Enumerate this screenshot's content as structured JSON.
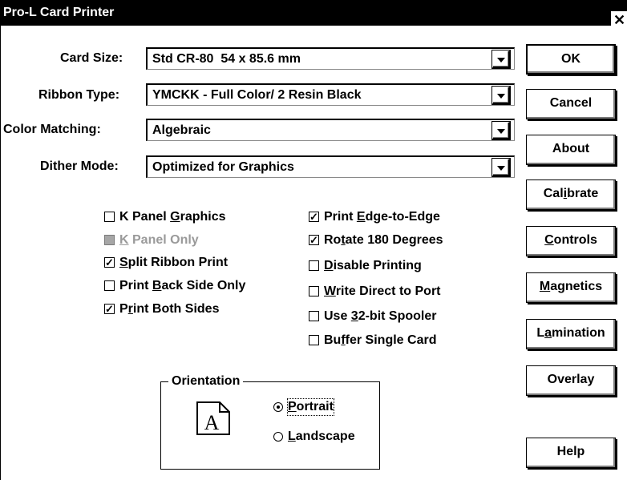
{
  "window": {
    "title": "Pro-L Card Printer",
    "close_glyph": "✕"
  },
  "fields": [
    {
      "label": "Card Size:",
      "value": "Std CR-80  54 x 85.6 mm"
    },
    {
      "label": "Ribbon Type:",
      "value": "YMCKK - Full Color/ 2 Resin Black"
    },
    {
      "label": "Color Matching:",
      "value": "Algebraic"
    },
    {
      "label": "Dither Mode:",
      "value": "Optimized for Graphics"
    }
  ],
  "buttons": {
    "ok": "OK",
    "cancel": "Cancel",
    "about": "About",
    "calibrate": {
      "pre": "Cal",
      "acc": "i",
      "post": "brate"
    },
    "controls": {
      "pre": "",
      "acc": "C",
      "post": "ontrols"
    },
    "magnetics": {
      "pre": "",
      "acc": "M",
      "post": "agnetics"
    },
    "lamination": {
      "pre": "L",
      "acc": "a",
      "post": "mination"
    },
    "overlay": "Overlay",
    "help": "Help"
  },
  "options_left": [
    {
      "pre": "K Panel ",
      "acc": "G",
      "post": "raphics",
      "checked": false,
      "enabled": true
    },
    {
      "pre": "",
      "acc": "K",
      "post": " Panel Only",
      "checked": false,
      "enabled": false
    },
    {
      "pre": "",
      "acc": "S",
      "post": "plit Ribbon Print",
      "checked": true,
      "enabled": true
    },
    {
      "pre": "Print ",
      "acc": "B",
      "post": "ack Side Only",
      "checked": false,
      "enabled": true
    },
    {
      "pre": "P",
      "acc": "r",
      "post": "int Both Sides",
      "checked": true,
      "enabled": true
    }
  ],
  "options_right": [
    {
      "pre": "Print ",
      "acc": "E",
      "post": "dge-to-Edge",
      "checked": true
    },
    {
      "pre": "Ro",
      "acc": "t",
      "post": "ate 180 Degrees",
      "checked": true
    },
    {
      "pre": "",
      "acc": "D",
      "post": "isable Printing",
      "checked": false
    },
    {
      "pre": "",
      "acc": "W",
      "post": "rite Direct to Port",
      "checked": false
    },
    {
      "pre": "Use ",
      "acc": "3",
      "post": "2-bit Spooler",
      "checked": false
    },
    {
      "pre": "Bu",
      "acc": "f",
      "post": "fer Single Card",
      "checked": false
    }
  ],
  "orientation": {
    "label": "Orientation",
    "icon_letter": "A",
    "portrait": {
      "pre": "",
      "acc": "P",
      "post": "ortrait",
      "selected": true
    },
    "landscape": {
      "pre": "",
      "acc": "L",
      "post": "andscape",
      "selected": false
    }
  },
  "glyphs": {
    "check": "✓"
  }
}
